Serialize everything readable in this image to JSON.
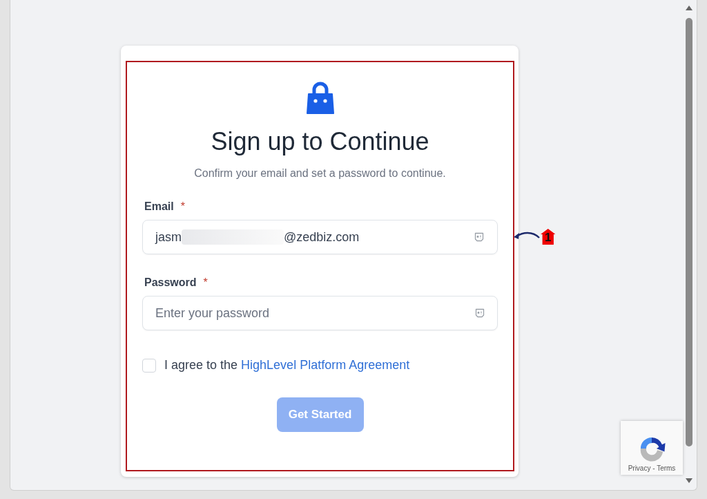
{
  "form": {
    "title": "Sign up to Continue",
    "subtitle": "Confirm your email and set a password to continue.",
    "fields": [
      {
        "kind": "email",
        "label": "Email",
        "required": "*",
        "value_start": "jasm",
        "value_end": "@zedbiz.com"
      },
      {
        "kind": "password",
        "label": "Password",
        "required": "*",
        "placeholder": "Enter your password"
      }
    ],
    "agreement": {
      "text": "I agree to the ",
      "link": "HighLevel Platform Agreement",
      "checked": false
    },
    "submit": {
      "label": "Get Started",
      "disabled": true
    }
  },
  "annotation": {
    "number": "1"
  },
  "recaptcha": {
    "links": "Privacy - Terms"
  }
}
